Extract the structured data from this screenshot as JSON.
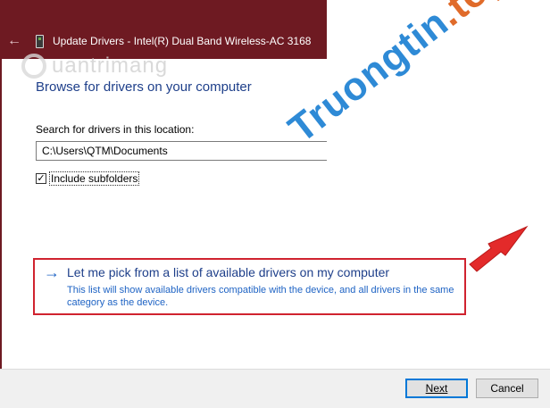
{
  "window": {
    "title": "Update Drivers - Intel(R) Dual Band Wireless-AC 3168"
  },
  "page": {
    "heading": "Browse for drivers on your computer",
    "search_label": "Search for drivers in this location:",
    "path_value": "C:\\Users\\QTM\\Documents",
    "include_subfolders_label": "Include subfolders",
    "include_subfolders_checked": true
  },
  "pick_option": {
    "title": "Let me pick from a list of available drivers on my computer",
    "description": "This list will show available drivers compatible with the device, and all drivers in the same category as the device."
  },
  "buttons": {
    "next": "Next",
    "cancel": "Cancel"
  },
  "watermarks": {
    "left": "uantrimang",
    "right_main": "Truongtin",
    "right_accent": ".top"
  },
  "colors": {
    "titlebar": "#6e1a22",
    "link": "#1e63c4",
    "heading": "#1e3f8a",
    "highlight_border": "#d0232f"
  },
  "icons": {
    "back": "back-arrow-icon",
    "device": "device-icon",
    "link_arrow": "right-arrow-icon",
    "pointer": "red-pointer-arrow-icon"
  }
}
